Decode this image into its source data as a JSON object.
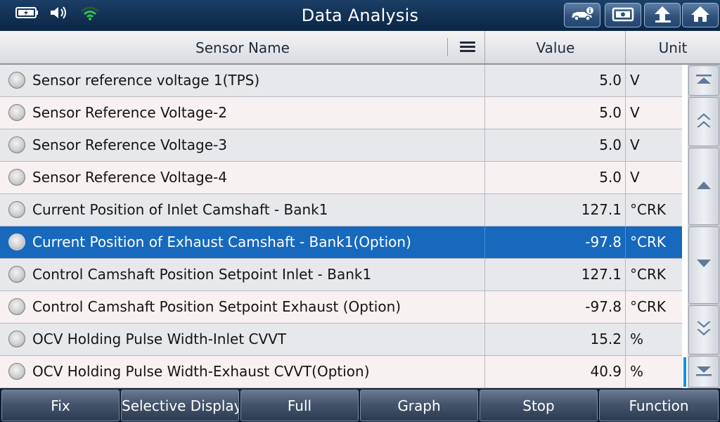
{
  "header": {
    "title": "Data Analysis",
    "icons": [
      "battery-icon",
      "speaker-icon",
      "wifi-icon",
      "vehicle-info-icon",
      "screenshot-icon",
      "back-icon",
      "home-icon"
    ]
  },
  "table": {
    "columns": {
      "name": "Sensor Name",
      "value": "Value",
      "unit": "Unit"
    },
    "selected_index": 5,
    "rows": [
      {
        "name": "Sensor reference voltage 1(TPS)",
        "value": "5.0",
        "unit": "V"
      },
      {
        "name": "Sensor Reference Voltage-2",
        "value": "5.0",
        "unit": "V"
      },
      {
        "name": "Sensor Reference Voltage-3",
        "value": "5.0",
        "unit": "V"
      },
      {
        "name": "Sensor Reference Voltage-4",
        "value": "5.0",
        "unit": "V"
      },
      {
        "name": "Current Position of Inlet Camshaft - Bank1",
        "value": "127.1",
        "unit": "°CRK"
      },
      {
        "name": "Current Position of Exhaust Camshaft - Bank1(Option)",
        "value": "-97.8",
        "unit": "°CRK"
      },
      {
        "name": "Control Camshaft Position Setpoint Inlet - Bank1",
        "value": "127.1",
        "unit": "°CRK"
      },
      {
        "name": "Control Camshaft Position Setpoint Exhaust (Option)",
        "value": "-97.8",
        "unit": "°CRK"
      },
      {
        "name": "OCV Holding Pulse Width-Inlet CVVT",
        "value": "15.2",
        "unit": "%"
      },
      {
        "name": "OCV Holding Pulse Width-Exhaust CVVT(Option)",
        "value": "40.9",
        "unit": "%"
      }
    ]
  },
  "scroll_buttons": [
    "scroll-top",
    "page-up",
    "line-up",
    "line-down",
    "page-down",
    "scroll-bottom"
  ],
  "bottom_buttons": [
    "Fix",
    "Selective Display",
    "Full",
    "Graph",
    "Stop",
    "Function"
  ],
  "colors": {
    "title_bar": "#133357",
    "selected_row": "#1769be",
    "row_odd": "#e7e8ec",
    "row_even": "#f8f1f1",
    "wifi": "#33c24a"
  }
}
